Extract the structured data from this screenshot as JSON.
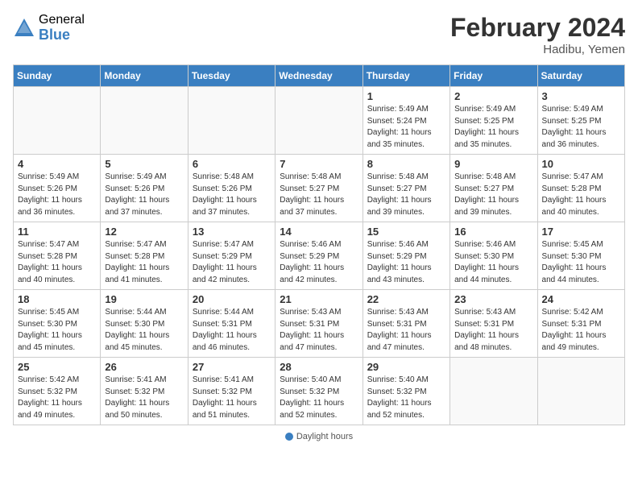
{
  "header": {
    "logo_general": "General",
    "logo_blue": "Blue",
    "month_year": "February 2024",
    "location": "Hadibu, Yemen"
  },
  "days_of_week": [
    "Sunday",
    "Monday",
    "Tuesday",
    "Wednesday",
    "Thursday",
    "Friday",
    "Saturday"
  ],
  "weeks": [
    [
      {
        "day": "",
        "sunrise": "",
        "sunset": "",
        "daylight": ""
      },
      {
        "day": "",
        "sunrise": "",
        "sunset": "",
        "daylight": ""
      },
      {
        "day": "",
        "sunrise": "",
        "sunset": "",
        "daylight": ""
      },
      {
        "day": "",
        "sunrise": "",
        "sunset": "",
        "daylight": ""
      },
      {
        "day": "1",
        "sunrise": "Sunrise: 5:49 AM",
        "sunset": "Sunset: 5:24 PM",
        "daylight": "Daylight: 11 hours and 35 minutes."
      },
      {
        "day": "2",
        "sunrise": "Sunrise: 5:49 AM",
        "sunset": "Sunset: 5:25 PM",
        "daylight": "Daylight: 11 hours and 35 minutes."
      },
      {
        "day": "3",
        "sunrise": "Sunrise: 5:49 AM",
        "sunset": "Sunset: 5:25 PM",
        "daylight": "Daylight: 11 hours and 36 minutes."
      }
    ],
    [
      {
        "day": "4",
        "sunrise": "Sunrise: 5:49 AM",
        "sunset": "Sunset: 5:26 PM",
        "daylight": "Daylight: 11 hours and 36 minutes."
      },
      {
        "day": "5",
        "sunrise": "Sunrise: 5:49 AM",
        "sunset": "Sunset: 5:26 PM",
        "daylight": "Daylight: 11 hours and 37 minutes."
      },
      {
        "day": "6",
        "sunrise": "Sunrise: 5:48 AM",
        "sunset": "Sunset: 5:26 PM",
        "daylight": "Daylight: 11 hours and 37 minutes."
      },
      {
        "day": "7",
        "sunrise": "Sunrise: 5:48 AM",
        "sunset": "Sunset: 5:27 PM",
        "daylight": "Daylight: 11 hours and 37 minutes."
      },
      {
        "day": "8",
        "sunrise": "Sunrise: 5:48 AM",
        "sunset": "Sunset: 5:27 PM",
        "daylight": "Daylight: 11 hours and 39 minutes."
      },
      {
        "day": "9",
        "sunrise": "Sunrise: 5:48 AM",
        "sunset": "Sunset: 5:27 PM",
        "daylight": "Daylight: 11 hours and 39 minutes."
      },
      {
        "day": "10",
        "sunrise": "Sunrise: 5:47 AM",
        "sunset": "Sunset: 5:28 PM",
        "daylight": "Daylight: 11 hours and 40 minutes."
      }
    ],
    [
      {
        "day": "11",
        "sunrise": "Sunrise: 5:47 AM",
        "sunset": "Sunset: 5:28 PM",
        "daylight": "Daylight: 11 hours and 40 minutes."
      },
      {
        "day": "12",
        "sunrise": "Sunrise: 5:47 AM",
        "sunset": "Sunset: 5:28 PM",
        "daylight": "Daylight: 11 hours and 41 minutes."
      },
      {
        "day": "13",
        "sunrise": "Sunrise: 5:47 AM",
        "sunset": "Sunset: 5:29 PM",
        "daylight": "Daylight: 11 hours and 42 minutes."
      },
      {
        "day": "14",
        "sunrise": "Sunrise: 5:46 AM",
        "sunset": "Sunset: 5:29 PM",
        "daylight": "Daylight: 11 hours and 42 minutes."
      },
      {
        "day": "15",
        "sunrise": "Sunrise: 5:46 AM",
        "sunset": "Sunset: 5:29 PM",
        "daylight": "Daylight: 11 hours and 43 minutes."
      },
      {
        "day": "16",
        "sunrise": "Sunrise: 5:46 AM",
        "sunset": "Sunset: 5:30 PM",
        "daylight": "Daylight: 11 hours and 44 minutes."
      },
      {
        "day": "17",
        "sunrise": "Sunrise: 5:45 AM",
        "sunset": "Sunset: 5:30 PM",
        "daylight": "Daylight: 11 hours and 44 minutes."
      }
    ],
    [
      {
        "day": "18",
        "sunrise": "Sunrise: 5:45 AM",
        "sunset": "Sunset: 5:30 PM",
        "daylight": "Daylight: 11 hours and 45 minutes."
      },
      {
        "day": "19",
        "sunrise": "Sunrise: 5:44 AM",
        "sunset": "Sunset: 5:30 PM",
        "daylight": "Daylight: 11 hours and 45 minutes."
      },
      {
        "day": "20",
        "sunrise": "Sunrise: 5:44 AM",
        "sunset": "Sunset: 5:31 PM",
        "daylight": "Daylight: 11 hours and 46 minutes."
      },
      {
        "day": "21",
        "sunrise": "Sunrise: 5:43 AM",
        "sunset": "Sunset: 5:31 PM",
        "daylight": "Daylight: 11 hours and 47 minutes."
      },
      {
        "day": "22",
        "sunrise": "Sunrise: 5:43 AM",
        "sunset": "Sunset: 5:31 PM",
        "daylight": "Daylight: 11 hours and 47 minutes."
      },
      {
        "day": "23",
        "sunrise": "Sunrise: 5:43 AM",
        "sunset": "Sunset: 5:31 PM",
        "daylight": "Daylight: 11 hours and 48 minutes."
      },
      {
        "day": "24",
        "sunrise": "Sunrise: 5:42 AM",
        "sunset": "Sunset: 5:31 PM",
        "daylight": "Daylight: 11 hours and 49 minutes."
      }
    ],
    [
      {
        "day": "25",
        "sunrise": "Sunrise: 5:42 AM",
        "sunset": "Sunset: 5:32 PM",
        "daylight": "Daylight: 11 hours and 49 minutes."
      },
      {
        "day": "26",
        "sunrise": "Sunrise: 5:41 AM",
        "sunset": "Sunset: 5:32 PM",
        "daylight": "Daylight: 11 hours and 50 minutes."
      },
      {
        "day": "27",
        "sunrise": "Sunrise: 5:41 AM",
        "sunset": "Sunset: 5:32 PM",
        "daylight": "Daylight: 11 hours and 51 minutes."
      },
      {
        "day": "28",
        "sunrise": "Sunrise: 5:40 AM",
        "sunset": "Sunset: 5:32 PM",
        "daylight": "Daylight: 11 hours and 52 minutes."
      },
      {
        "day": "29",
        "sunrise": "Sunrise: 5:40 AM",
        "sunset": "Sunset: 5:32 PM",
        "daylight": "Daylight: 11 hours and 52 minutes."
      },
      {
        "day": "",
        "sunrise": "",
        "sunset": "",
        "daylight": ""
      },
      {
        "day": "",
        "sunrise": "",
        "sunset": "",
        "daylight": ""
      }
    ]
  ],
  "legend": {
    "daylight_label": "Daylight hours"
  }
}
